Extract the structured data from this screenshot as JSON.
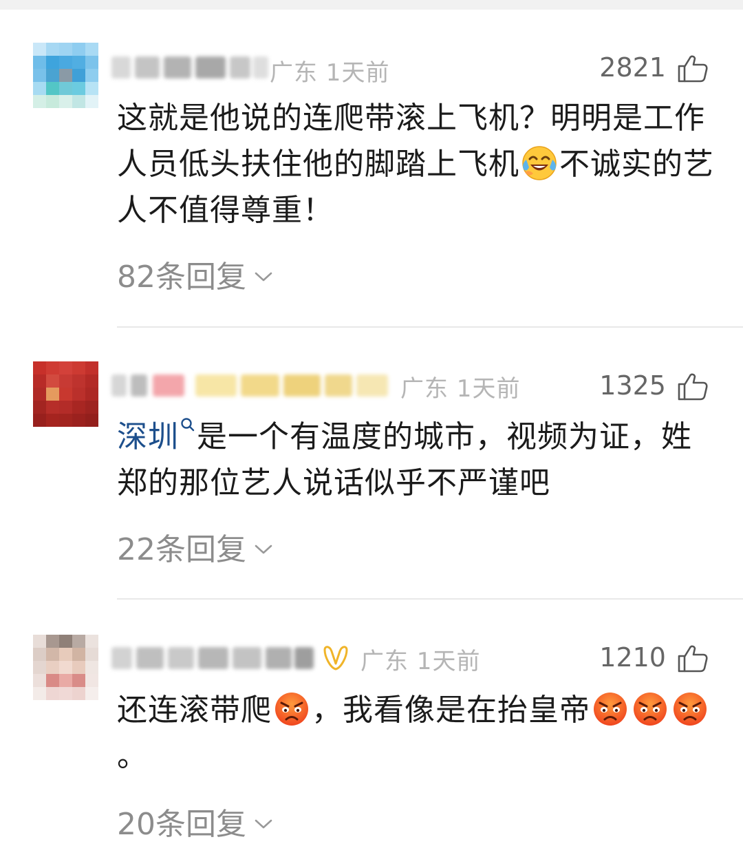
{
  "comments": [
    {
      "location_time": "广东 1天前",
      "likes": "2821",
      "text_parts": [
        "这就是他说的连爬带滚上飞机？明明是工作人员低头扶住他的脚踏上飞机",
        "不诚实的艺人不值得尊重！"
      ],
      "emoji": "laughing-crying-emoji",
      "replies": "82条回复"
    },
    {
      "location_time": "广东 1天前",
      "likes": "1325",
      "link_word": "深圳",
      "text": "是一个有温度的城市，视频为证，姓郑的那位艺人说话似乎不严谨吧",
      "replies": "22条回复"
    },
    {
      "location_time": "广东 1天前",
      "likes": "1210",
      "text_parts": [
        "还连滚带爬",
        "，我看像是在抬皇帝",
        "。"
      ],
      "emoji": "angry-face-emoji",
      "replies": "20条回复"
    }
  ],
  "icons": {
    "like": "thumbs-up-icon",
    "search": "search-icon",
    "expand": "chevron-down-icon",
    "vip": "vip-badge-icon"
  },
  "colors": {
    "link": "#1d4f8c",
    "meta": "#b5b5b5",
    "likes": "#666666",
    "replies": "#8c8c8c",
    "vip_badge": "#f0b429",
    "divider": "#e8e8e8"
  }
}
